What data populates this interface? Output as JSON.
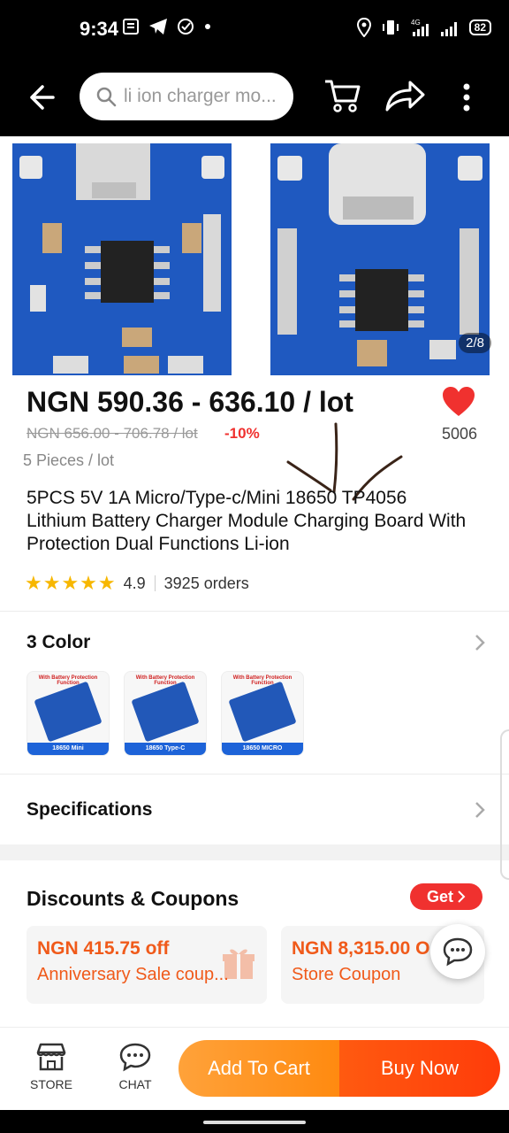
{
  "status_bar": {
    "time": "9:34",
    "battery": "82"
  },
  "search": {
    "placeholder": "li ion charger mo..."
  },
  "gallery": {
    "page_indicator": "2/8"
  },
  "product": {
    "price": "NGN 590.36 - 636.10 / lot",
    "old_price": "NGN 656.00 - 706.78 / lot",
    "discount": "-10%",
    "likes": "5006",
    "unit": "5 Pieces / lot",
    "title": "5PCS 5V 1A Micro/Type-c/Mini 18650 TP4056 Lithium Battery Charger Module Charging Board With Protection Dual Functions  Li-ion",
    "rating": "4.9",
    "orders": "3925 orders",
    "stars": 5
  },
  "color_section": {
    "title": "3 Color",
    "swatches": [
      {
        "caption": "With Battery Protection Function",
        "label": "18650 Mini"
      },
      {
        "caption": "With Battery Protection Function",
        "label": "18650 Type-C"
      },
      {
        "caption": "With Battery Protection Function",
        "label": "18650 MICRO"
      }
    ]
  },
  "specifications": {
    "title": "Specifications"
  },
  "coupons": {
    "title": "Discounts & Coupons",
    "get_label": "Get",
    "items": [
      {
        "amount": "NGN 415.75 off",
        "desc": "Anniversary Sale coup..."
      },
      {
        "amount": "NGN 8,315.00 O",
        "desc": "Store Coupon"
      }
    ]
  },
  "bottom_bar": {
    "store_label": "STORE",
    "chat_label": "CHAT",
    "add_to_cart": "Add To Cart",
    "buy_now": "Buy Now"
  },
  "colors": {
    "accent_red": "#f0312f",
    "orange": "#ff8a10",
    "status_bg": "#000000"
  }
}
